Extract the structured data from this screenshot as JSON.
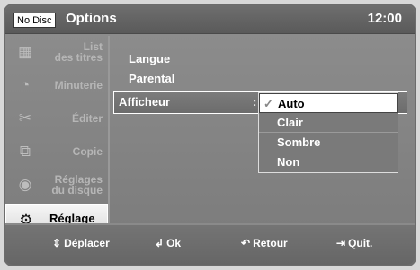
{
  "header": {
    "nodisc": "No Disc",
    "title": "Options",
    "time": "12:00"
  },
  "sidebar": {
    "items": [
      {
        "label": "List\ndes titres",
        "icon": "film-icon"
      },
      {
        "label": "Minuterie",
        "icon": "clock-icon"
      },
      {
        "label": "Éditer",
        "icon": "scissors-icon"
      },
      {
        "label": "Copie",
        "icon": "copy-icon"
      },
      {
        "label": "Réglages\ndu disque",
        "icon": "disc-icon"
      },
      {
        "label": "Réglage",
        "icon": "gear-icon"
      }
    ]
  },
  "menu": {
    "langue": "Langue",
    "parental": "Parental",
    "afficheur": "Afficheur",
    "colon": ":"
  },
  "dropdown": {
    "options": [
      "Auto",
      "Clair",
      "Sombre",
      "Non"
    ],
    "selected": "Auto"
  },
  "footer": {
    "move": "Déplacer",
    "ok": "Ok",
    "back": "Retour",
    "quit": "Quit."
  }
}
